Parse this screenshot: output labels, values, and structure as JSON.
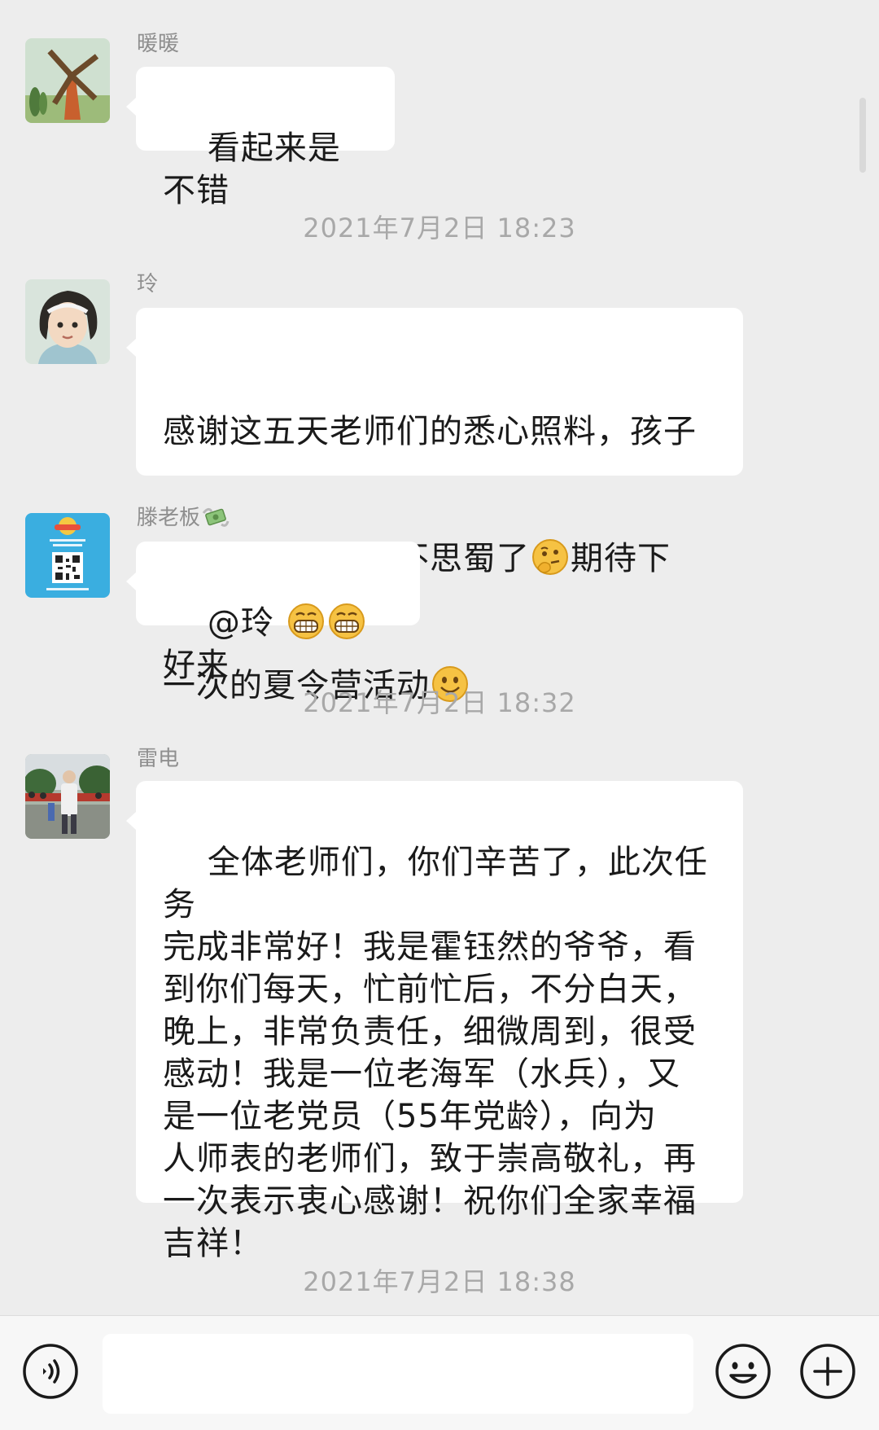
{
  "messages": [
    {
      "sender": "暖暖",
      "text": "看起来是不错",
      "avatar_icon": "windmill-avatar-icon"
    },
    {
      "timestamp": "2021年7月2日 18:23"
    },
    {
      "sender": "玲",
      "text_line1": "感谢这五天老师们的悉心照料，孩子",
      "text_line2_a": "非常开心，都乐不思蜀了",
      "text_line2_b": "期待下",
      "text_line3": "一次的夏令营活动",
      "avatar_icon": "girl-avatar-icon"
    },
    {
      "sender": "滕老板",
      "sender_emoji": "money-wings-icon",
      "text_a": "@玲 ",
      "text_b": "好来",
      "avatar_icon": "qr-poster-avatar-icon"
    },
    {
      "timestamp": "2021年7月2日 18:32"
    },
    {
      "sender": "雷电",
      "text": "全体老师们，你们辛苦了，此次任务\n完成非常好！我是霍钰然的爷爷，看\n到你们每天，忙前忙后，不分白天，\n晚上，非常负责任，细微周到，很受\n感动！我是一位老海军（水兵），又\n是一位老党员（55年党龄），向为\n人师表的老师们，致于崇高敬礼，再\n一次表示衷心感谢！祝你们全家幸福\n吉祥！",
      "avatar_icon": "photo-avatar-icon"
    },
    {
      "timestamp": "2021年7月2日 18:38"
    }
  ],
  "input_bar": {
    "voice_icon": "voice-icon",
    "emoji_icon": "smiley-icon",
    "plus_icon": "plus-icon",
    "input_value": ""
  },
  "colors": {
    "background": "#ededed",
    "bubble": "#ffffff",
    "name_text": "#8f8f8f",
    "timestamp_text": "#a8a8a8"
  }
}
